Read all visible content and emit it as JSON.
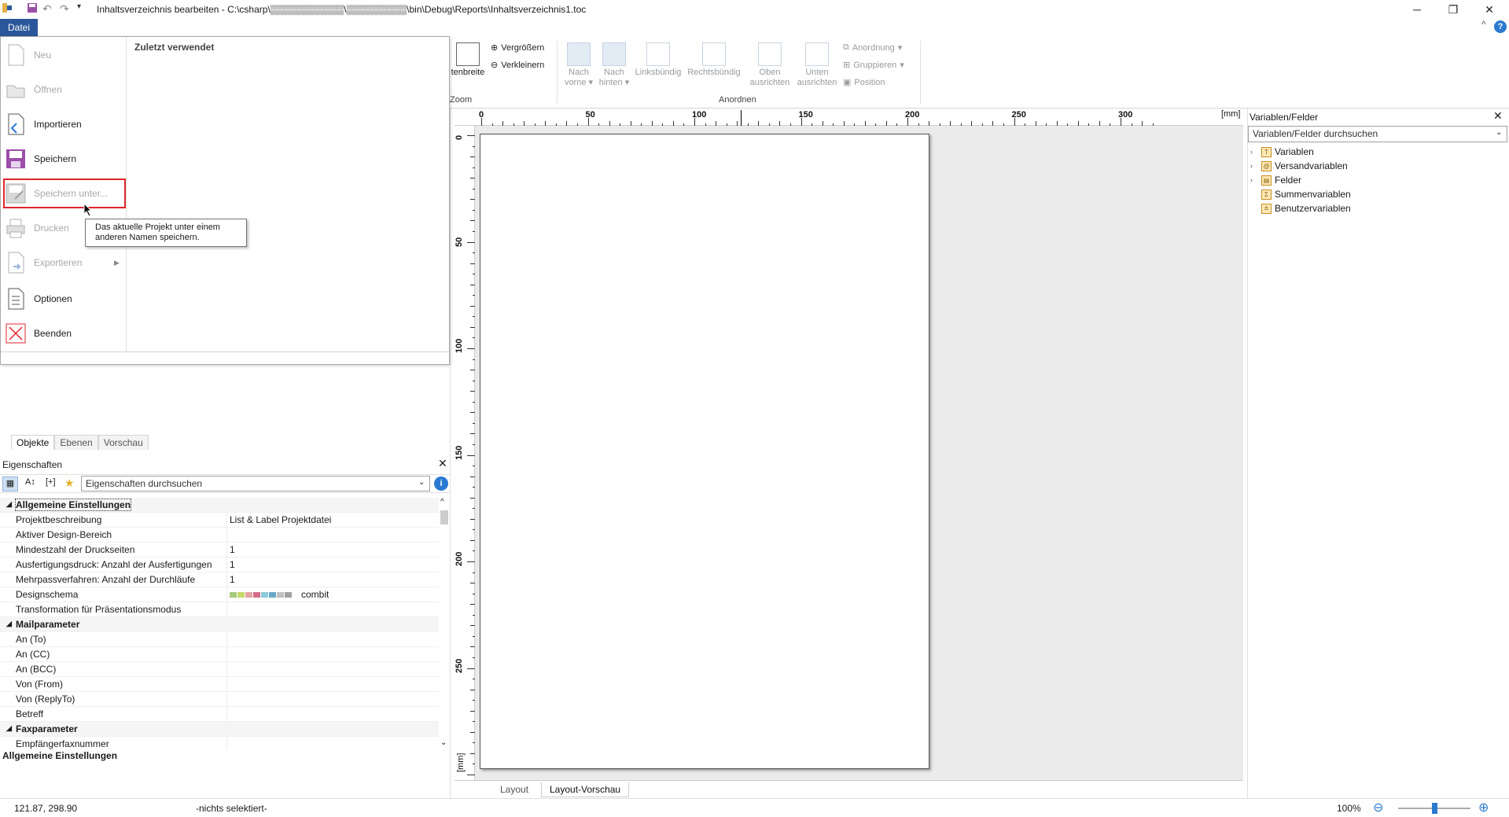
{
  "window": {
    "title": "Inhaltsverzeichnis bearbeiten - C:\\csharp\\▒▒▒▒▒▒▒▒▒▒▒\\▒▒▒▒▒▒▒▒▒\\bin\\Debug\\Reports\\Inhaltsverzeichnis1.toc",
    "minimize": "─",
    "restore": "❐",
    "close": "✕"
  },
  "ribbon": {
    "file_tab": "Datei",
    "help": "?",
    "collapse": "^",
    "zoom_group": {
      "page_width": "tenbreite",
      "zoom_in": "Vergrößern",
      "zoom_out": "Verkleinern",
      "label": "Zoom"
    },
    "arrange_group": {
      "bring_front": [
        "Nach",
        "vorne"
      ],
      "send_back": [
        "Nach",
        "hinten"
      ],
      "align_left": "Linksbündig",
      "align_right": "Rechtsbündig",
      "align_top": [
        "Oben",
        "ausrichten"
      ],
      "align_bottom": [
        "Unten",
        "ausrichten"
      ],
      "order": "Anordnung",
      "group": "Gruppieren",
      "position": "Position",
      "label": "Anordnen"
    }
  },
  "backstage": {
    "recent_header": "Zuletzt verwendet",
    "items": [
      {
        "label": "Neu",
        "enabled": false
      },
      {
        "label": "Öffnen",
        "enabled": false
      },
      {
        "label": "Importieren",
        "enabled": true
      },
      {
        "label": "Speichern",
        "enabled": true
      },
      {
        "label": "Speichern unter...",
        "enabled": false
      },
      {
        "label": "Drucken",
        "enabled": false
      },
      {
        "label": "Exportieren",
        "enabled": false
      },
      {
        "label": "Optionen",
        "enabled": true
      },
      {
        "label": "Beenden",
        "enabled": true
      }
    ],
    "tooltip": "Das aktuelle Projekt unter einem anderen Namen speichern."
  },
  "object_tabs": [
    "Objekte",
    "Ebenen",
    "Vorschau"
  ],
  "properties": {
    "title": "Eigenschaften",
    "search_placeholder": "Eigenschaften durchsuchen",
    "rows": [
      {
        "type": "cat",
        "key": "Allgemeine Einstellungen"
      },
      {
        "type": "prop",
        "key": "Projektbeschreibung",
        "value": "List & Label Projektdatei"
      },
      {
        "type": "prop",
        "key": "Aktiver Design-Bereich",
        "value": ""
      },
      {
        "type": "prop",
        "key": "Mindestzahl der Druckseiten",
        "value": "1"
      },
      {
        "type": "prop",
        "key": "Ausfertigungsdruck: Anzahl der Ausfertigungen",
        "value": "1"
      },
      {
        "type": "prop",
        "key": "Mehrpassverfahren: Anzahl der Durchläufe",
        "value": "1"
      },
      {
        "type": "prop",
        "key": "Designschema",
        "value": "combit"
      },
      {
        "type": "prop",
        "key": "Transformation für Präsentationsmodus",
        "value": ""
      },
      {
        "type": "cat",
        "key": "Mailparameter"
      },
      {
        "type": "prop",
        "key": "An (To)",
        "value": ""
      },
      {
        "type": "prop",
        "key": "An (CC)",
        "value": ""
      },
      {
        "type": "prop",
        "key": "An (BCC)",
        "value": ""
      },
      {
        "type": "prop",
        "key": "Von (From)",
        "value": ""
      },
      {
        "type": "prop",
        "key": "Von (ReplyTo)",
        "value": ""
      },
      {
        "type": "prop",
        "key": "Betreff",
        "value": ""
      },
      {
        "type": "cat",
        "key": "Faxparameter"
      },
      {
        "type": "prop",
        "key": "Empfängerfaxnummer",
        "value": ""
      }
    ],
    "footer": "Allgemeine Einstellungen",
    "scheme_colors": [
      "#a7c97b",
      "#c6d96d",
      "#e2a3a3",
      "#d36c8a",
      "#8ec9d8",
      "#6aa7c9",
      "#c1c1c1",
      "#a0a0a0"
    ]
  },
  "ruler": {
    "h_labels": [
      "0",
      "50",
      "100",
      "150",
      "200",
      "250",
      "300"
    ],
    "unit": "[mm]",
    "v_labels": [
      "0",
      "50",
      "100",
      "150",
      "200",
      "250"
    ]
  },
  "canvas_tabs": [
    "Layout",
    "Layout-Vorschau"
  ],
  "variables": {
    "title": "Variablen/Felder",
    "search_placeholder": "Variablen/Felder durchsuchen",
    "tree": [
      {
        "label": "Variablen",
        "expandable": true,
        "icon": "T"
      },
      {
        "label": "Versandvariablen",
        "expandable": true,
        "icon": "@"
      },
      {
        "label": "Felder",
        "expandable": true,
        "icon": "▤"
      },
      {
        "label": "Summenvariablen",
        "expandable": false,
        "icon": "Σ"
      },
      {
        "label": "Benutzervariablen",
        "expandable": false,
        "icon": "≗"
      }
    ]
  },
  "status": {
    "coords": "121.87, 298.90",
    "selection": "-nichts selektiert-",
    "zoom": "100%",
    "zoom_level": 0.5
  }
}
